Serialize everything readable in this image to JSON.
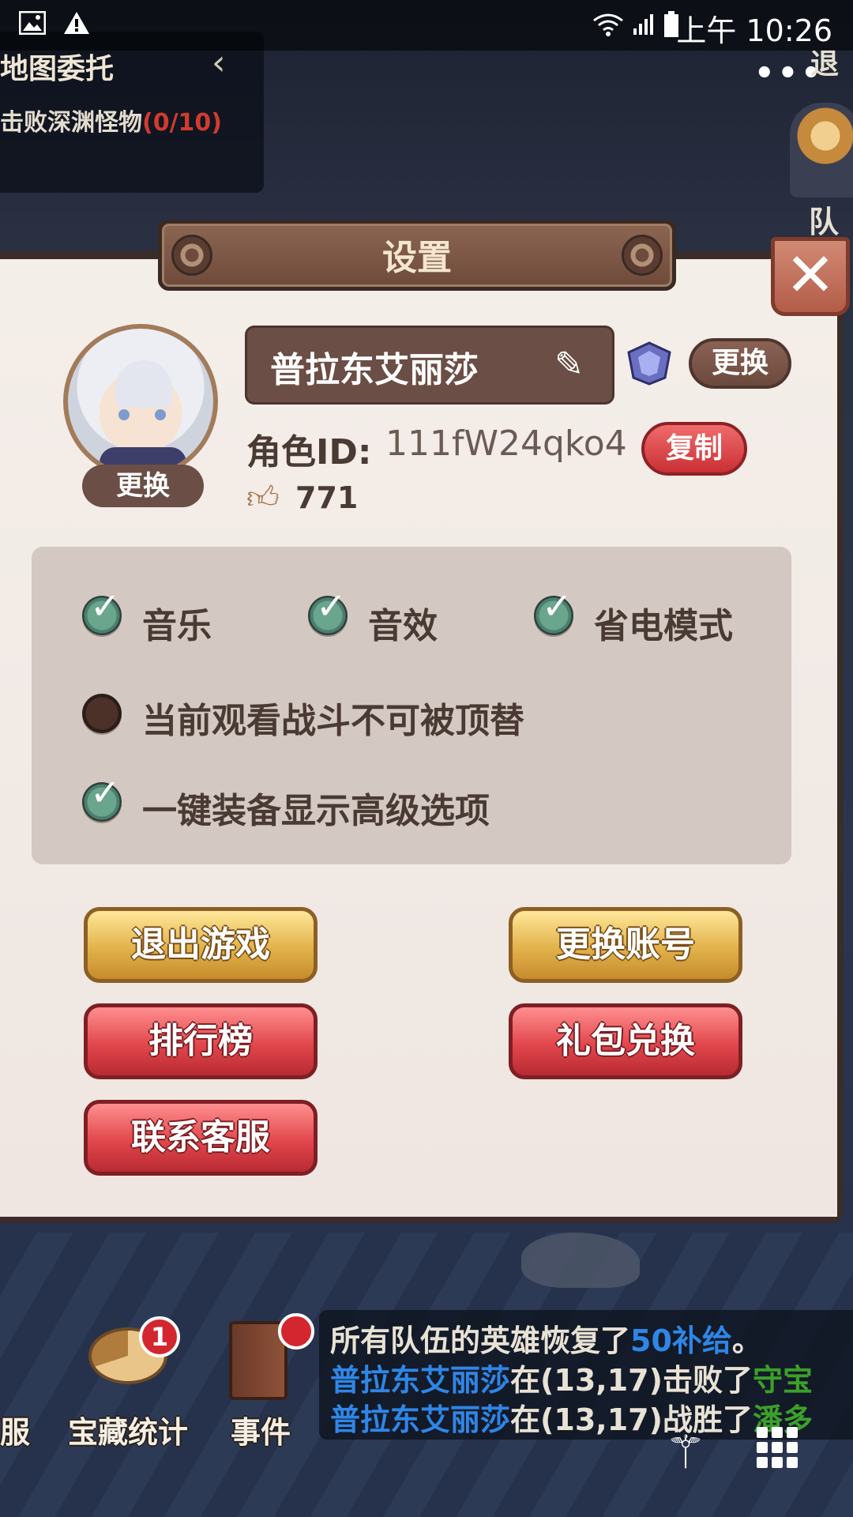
{
  "status_bar": {
    "time": "上午 10:26",
    "left_icons": [
      "image-icon",
      "warning-icon"
    ],
    "right_icons": [
      "wifi-icon",
      "signal-icon",
      "battery-icon"
    ]
  },
  "background": {
    "quest_panel": {
      "title": "地图委托",
      "task_text": "击败深渊怪物",
      "task_progress": "(0/10)"
    },
    "top_right_exit": "退",
    "top_right_team": "队伍",
    "more_menu": "•••"
  },
  "dialog": {
    "title": "设置",
    "profile": {
      "avatar_change_label": "更换",
      "name": "普拉东艾丽莎",
      "name_change_label": "更换",
      "role_id_label": "角色ID:",
      "role_id_value": "111fW24qko4",
      "copy_label": "复制",
      "likes": "771"
    },
    "options": [
      {
        "label": "音乐",
        "checked": true
      },
      {
        "label": "音效",
        "checked": true
      },
      {
        "label": "省电模式",
        "checked": true
      },
      {
        "label": "当前观看战斗不可被顶替",
        "checked": false
      },
      {
        "label": "一键装备显示高级选项",
        "checked": true
      }
    ],
    "buttons": {
      "exit_game": "退出游戏",
      "switch_account": "更换账号",
      "leaderboard": "排行榜",
      "gift_redeem": "礼包兑换",
      "contact_support": "联系客服"
    }
  },
  "bottom": {
    "left_label_fragment": "服",
    "treasure_stats": "宝藏统计",
    "treasure_badge": "1",
    "events": "事件",
    "log": [
      {
        "parts": [
          {
            "t": "所有队伍的英雄恢复了",
            "c": "white"
          },
          {
            "t": "50补给",
            "c": "blue"
          },
          {
            "t": "。",
            "c": "white"
          }
        ]
      },
      {
        "parts": [
          {
            "t": "普拉东艾丽莎",
            "c": "blue"
          },
          {
            "t": "在(13,17)击败了",
            "c": "white"
          },
          {
            "t": "守宝",
            "c": "green"
          }
        ]
      },
      {
        "parts": [
          {
            "t": "普拉东艾丽莎",
            "c": "blue"
          },
          {
            "t": "在(13,17)战胜了",
            "c": "white"
          },
          {
            "t": "潘多",
            "c": "green"
          }
        ]
      }
    ]
  }
}
